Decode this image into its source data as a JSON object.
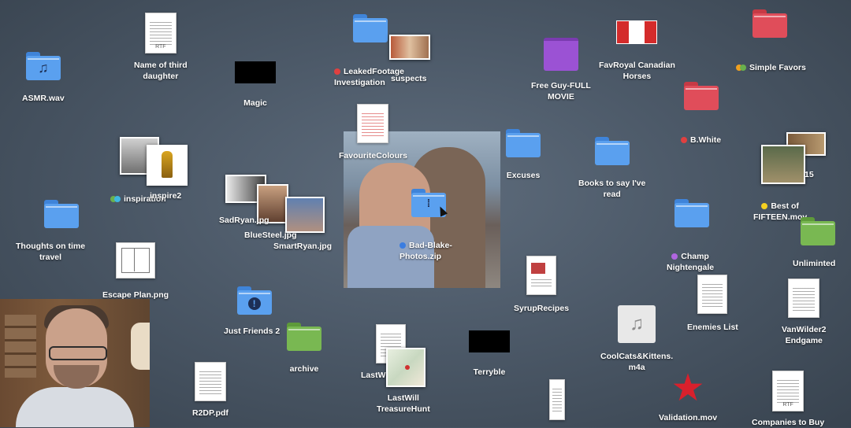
{
  "icons": {
    "asmr": {
      "label": "ASMR.wav",
      "icon": "music-note-icon",
      "glyph": "♫"
    },
    "third_daughter": {
      "label": "Name of third\ndaughter",
      "file_tag": "RTF"
    },
    "magic": {
      "label": "Magic"
    },
    "leaked": {
      "label": "LeakedFootage\nInvestigation",
      "tag_color": "#e04040"
    },
    "suspects": {
      "label": "suspects"
    },
    "free_guy": {
      "label": "Free Guy-FULL\nMOVIE"
    },
    "canadian": {
      "label": "FavRoyal Canadian\nHorses"
    },
    "simple_favors": {
      "label": "Simple Favors",
      "tag_colors": [
        "#f0a020",
        "#6ab04c"
      ]
    },
    "b_white": {
      "label": "B.White",
      "tag_color": "#e04040"
    },
    "favourite_colours": {
      "label": "FavouriteColours"
    },
    "excuses": {
      "label": "Excuses"
    },
    "books": {
      "label": "Books to say I've\nread"
    },
    "best_fifteen": {
      "label": "Best of\nFIFTEEN.mov",
      "tag_color": "#f5d020",
      "side_text": "15"
    },
    "inspiration": {
      "label": "inspiration",
      "tag_colors": [
        "#6ab04c",
        "#3fb8e0"
      ]
    },
    "inspire2": {
      "label": "inspire2"
    },
    "sadryan": {
      "label": "SadRyan.jpg"
    },
    "bluesteel": {
      "label": "BlueSteel.jpg"
    },
    "smartryan": {
      "label": "SmartRyan.jpg"
    },
    "bad_blake": {
      "label": "Bad-Blake-\nPhotos.zip",
      "tag_color": "#3b7de0"
    },
    "thoughts": {
      "label": "Thoughts on  time\ntravel"
    },
    "champ": {
      "label": "Champ\nNightengale",
      "tag_color": "#b066e0"
    },
    "unlimited": {
      "label": "Unliminted"
    },
    "escape": {
      "label": "Escape Plan.png"
    },
    "syrup": {
      "label": "SyrupRecipes"
    },
    "enemies": {
      "label": "Enemies List"
    },
    "vanwilder": {
      "label": "VanWilder2\nEndgame"
    },
    "just_friends": {
      "label": "Just Friends 2",
      "glyph": "!"
    },
    "archive": {
      "label": "archive"
    },
    "lastw": {
      "label": "LastW"
    },
    "lastwill": {
      "label": "LastWill\nTreasureHunt"
    },
    "terryble": {
      "label": "Terryble"
    },
    "coolcats": {
      "label": "CoolCats&Kittens.\nm4a",
      "glyph": "♫"
    },
    "r2dp": {
      "label": "R2DP.pdf"
    },
    "validation": {
      "label": "Validation.mov",
      "glyph": "★"
    },
    "companies": {
      "label": "Companies to Buy",
      "file_tag": "RTF"
    }
  }
}
